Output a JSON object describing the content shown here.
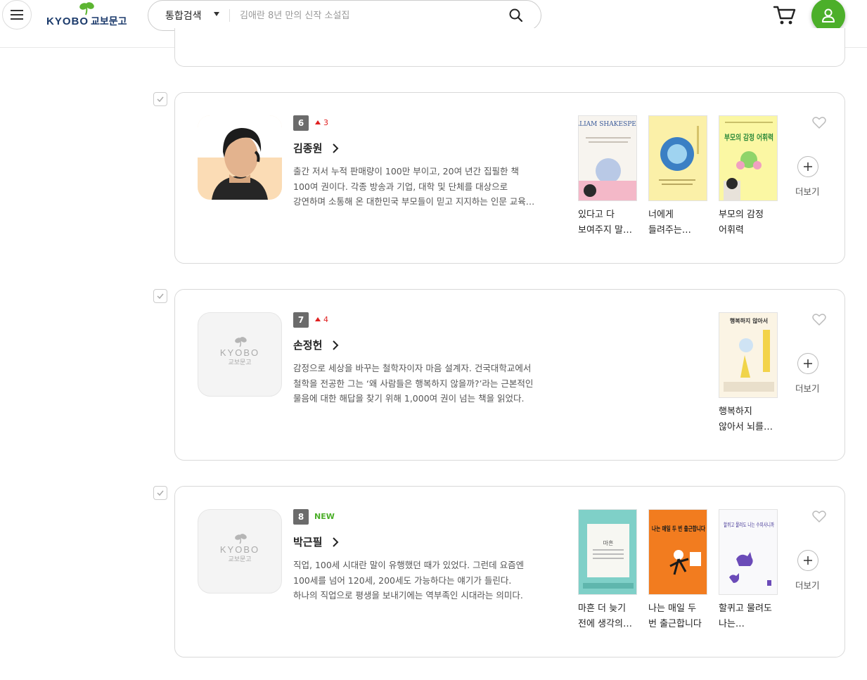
{
  "header": {
    "logo_en": "KYOBO",
    "logo_ko": "교보문고",
    "search_category": "통합검색",
    "search_placeholder": "김애란 8년 만의 신작 소설집"
  },
  "colors": {
    "brand_green": "#4caf2a",
    "rank_up_red": "#e02020",
    "logo_navy": "#1b3a6b"
  },
  "authors": [
    {
      "rank": "6",
      "change": "3",
      "name": "김종원",
      "description": "출간 저서 누적 판매량이 100만 부이고, 20여 년간 집필한 책 100여 권이다. 각종 방송과 기업, 대학 및 단체를 대상으로 강연하며 소통해 온 대한민국 부모들이 믿고 지지하는 인문 교육 전문가다.",
      "more_label": "더보기",
      "books": [
        {
          "title": "있다고 다 보여주지 말고 안다고 다 말하지 마라",
          "cover_en": "WILLIAM SHAKESPEARE"
        },
        {
          "title": "너에게 들려주는 꼿꼿한 말"
        },
        {
          "title": "부모의 감정 어휘력",
          "cover_text": "부모의 감정 어휘력"
        }
      ]
    },
    {
      "rank": "7",
      "change": "4",
      "name": "손정헌",
      "description": "감정으로 세상을 바꾸는 철학자이자 마음 설계자. 건국대학교에서 철학을 전공한 그는 ‘왜 사람들은 행복하지 않을까?’라는 근본적인 물음에 대한 해답을 찾기 위해 1,000여 권이 넘는 책을 읽었다.",
      "more_label": "더보기",
      "avatar_en": "KYOBO",
      "avatar_ko": "교보문고",
      "books": [
        {
          "title": "행복하지 않아서 뇌를 바꾸려고 합니다",
          "cover_text": "행복하지 않아서"
        }
      ]
    },
    {
      "rank": "8",
      "change": "NEW",
      "name": "박근필",
      "description": "직업, 100세 시대란 말이 유행했던 때가 있었다. 그런데 요즘엔 100세를 넘어 120세, 200세도 가능하다는 얘기가 들린다. 하나의 직업으로 평생을 보내기에는 역부족인 시대라는 의미다.",
      "more_label": "더보기",
      "avatar_en": "KYOBO",
      "avatar_ko": "교보문고",
      "books": [
        {
          "title": "마흔 더 늦기 전에 생각의 틀을 바꿔라",
          "cover_text": "마흔"
        },
        {
          "title": "나는 매일 두 번 출근합니다",
          "cover_text": "나는 매일 두 번 출근합니다"
        },
        {
          "title": "할퀴고 물려도 나는 수의사니까",
          "cover_text": "할퀴고 물려도 나는 수의사니까"
        }
      ]
    }
  ]
}
